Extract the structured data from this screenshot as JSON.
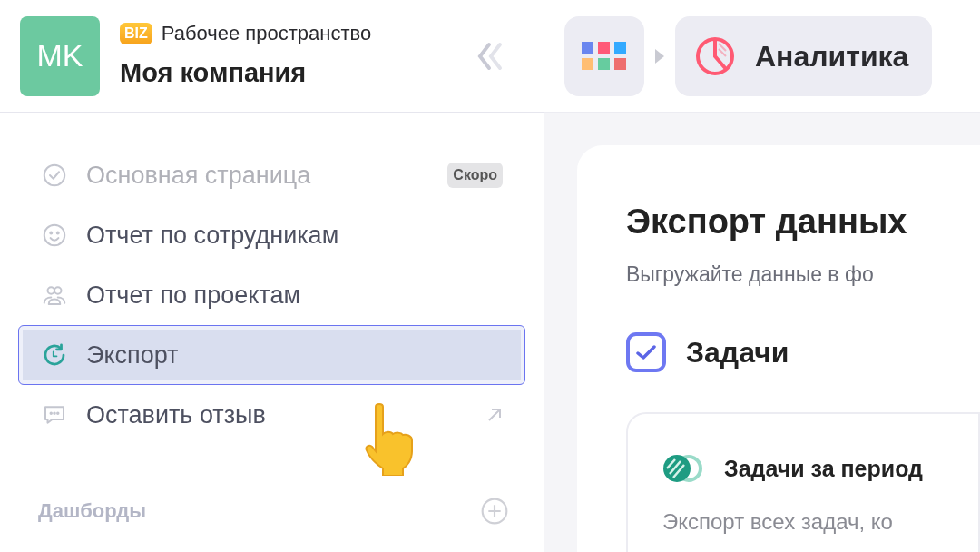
{
  "workspace": {
    "avatar": "MK",
    "plan_badge": "BIZ",
    "label": "Рабочее пространство",
    "name": "Моя компания"
  },
  "nav": [
    {
      "label": "Основная страница",
      "kind": "home",
      "disabled": true,
      "selected": false,
      "badge": "Скоро",
      "external": false
    },
    {
      "label": "Отчет по сотрудникам",
      "kind": "people",
      "disabled": false,
      "selected": false,
      "external": false
    },
    {
      "label": "Отчет по проектам",
      "kind": "projects",
      "disabled": false,
      "selected": false,
      "external": false
    },
    {
      "label": "Экспорт",
      "kind": "export",
      "disabled": false,
      "selected": true,
      "external": false
    },
    {
      "label": "Оставить отзыв",
      "kind": "feedback",
      "disabled": false,
      "selected": false,
      "external": true
    }
  ],
  "dashboards": {
    "label": "Дашборды"
  },
  "breadcrumb": {
    "current": "Аналитика"
  },
  "main": {
    "title": "Экспорт данных",
    "subtitle": "Выгружайте данные в фо",
    "section": {
      "label": "Задачи",
      "checked": true
    },
    "card": {
      "title": "Задачи за период",
      "description": "Экспорт всех задач, ко"
    }
  }
}
